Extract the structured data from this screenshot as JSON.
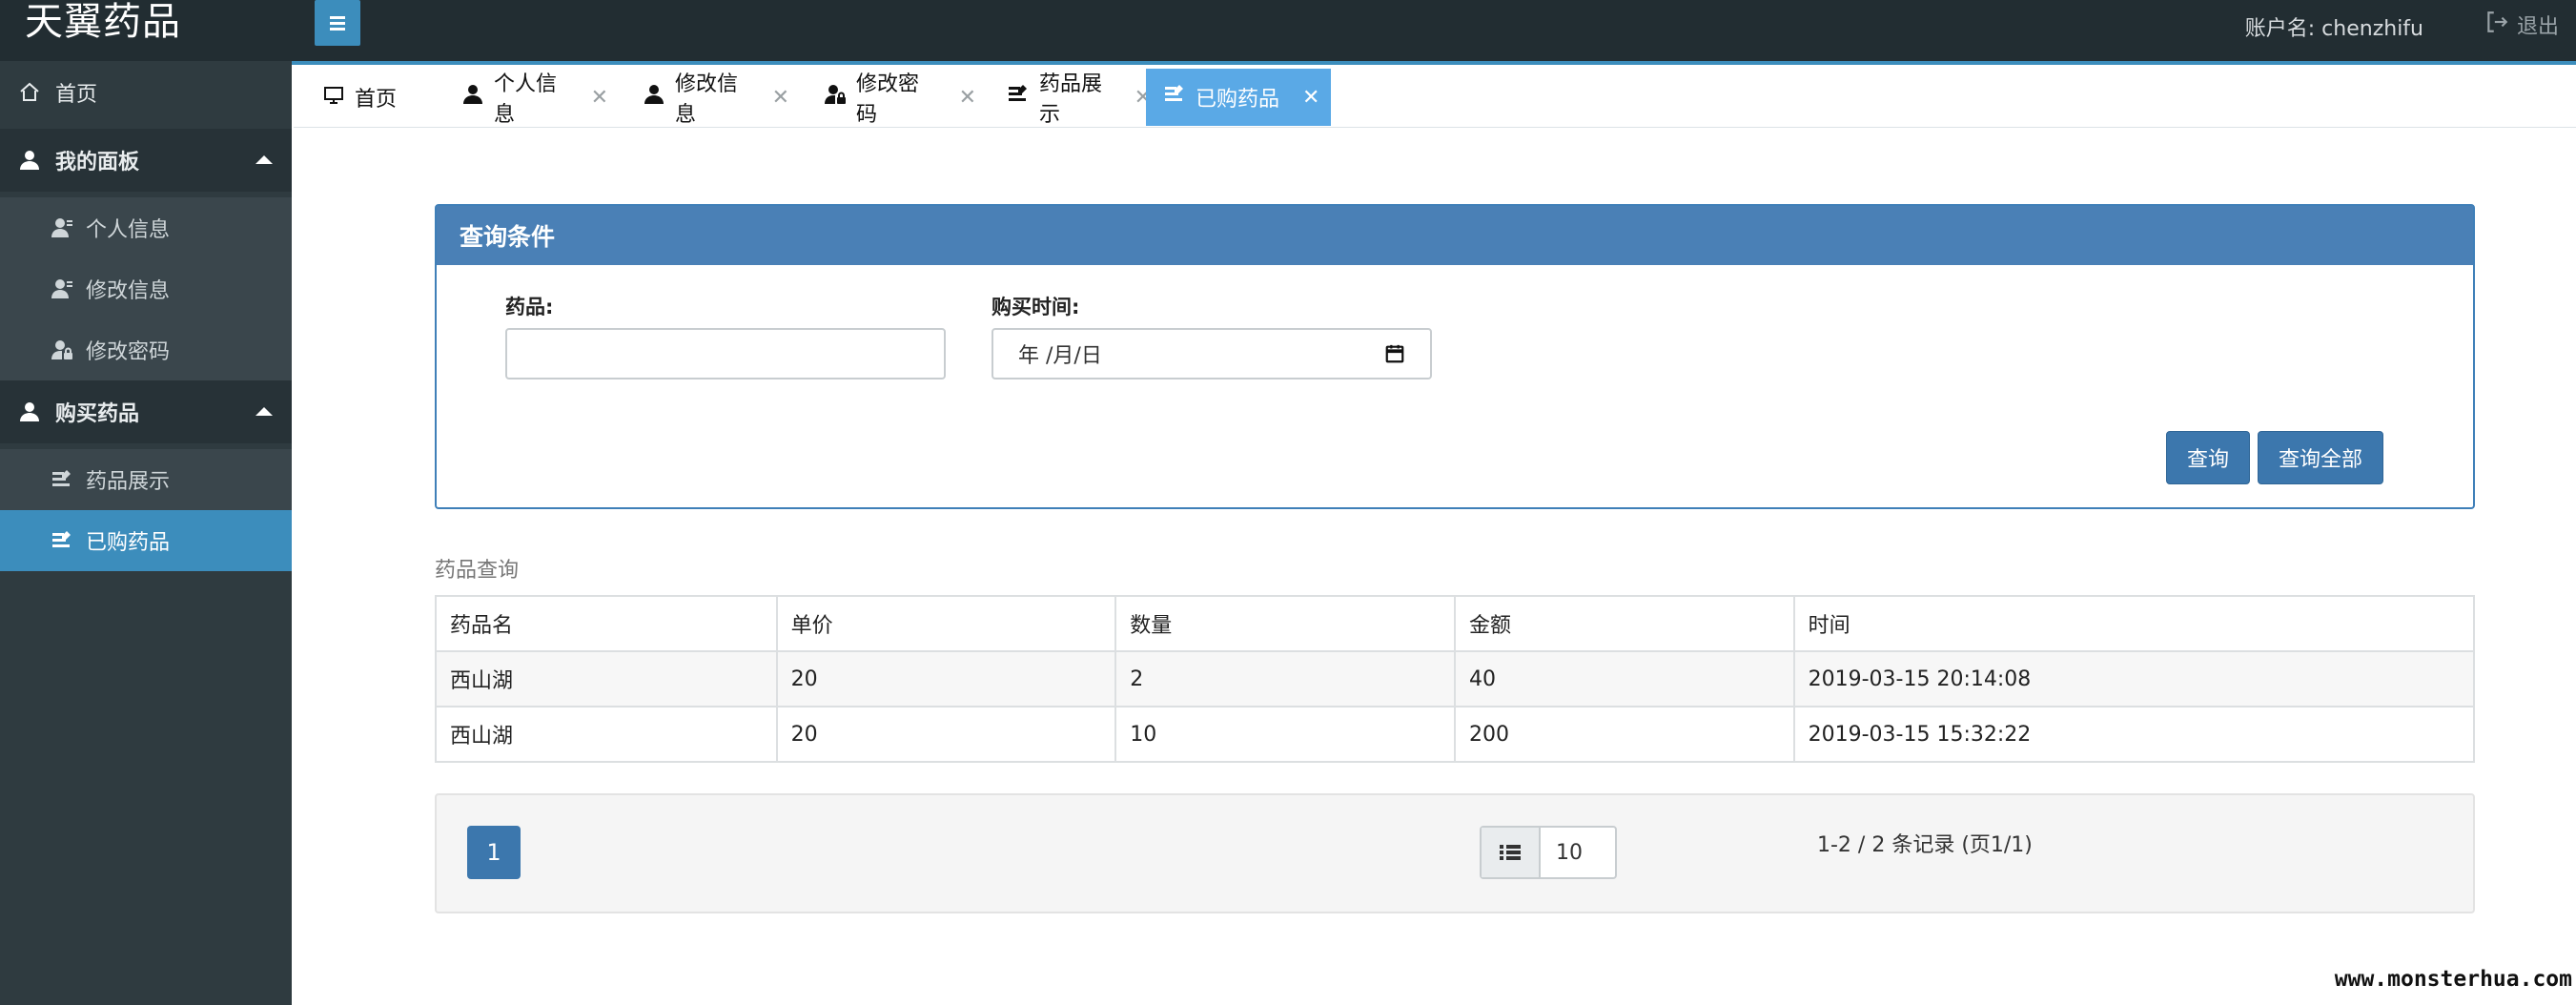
{
  "header": {
    "brand": "天翼药品",
    "account_label": "账户名: chenzhifu",
    "logout_label": "退出"
  },
  "sidebar": {
    "home": "首页",
    "groups": [
      {
        "label": "我的面板",
        "items": [
          "个人信息",
          "修改信息",
          "修改密码"
        ]
      },
      {
        "label": "购买药品",
        "items": [
          "药品展示",
          "已购药品"
        ]
      }
    ]
  },
  "tabs": [
    "首页",
    "个人信息",
    "修改信息",
    "修改密码",
    "药品展示",
    "已购药品"
  ],
  "active_tab": "已购药品",
  "query": {
    "title": "查询条件",
    "drug_label": "药品:",
    "drug_value": "",
    "date_label": "购买时间:",
    "date_placeholder": "年 /月/日",
    "query_button": "查询",
    "query_all_button": "查询全部"
  },
  "results": {
    "title": "药品查询",
    "columns": [
      "药品名",
      "单价",
      "数量",
      "金额",
      "时间"
    ],
    "rows": [
      [
        "西山湖",
        "20",
        "2",
        "40",
        "2019-03-15 20:14:08"
      ],
      [
        "西山湖",
        "20",
        "10",
        "200",
        "2019-03-15 15:32:22"
      ]
    ]
  },
  "pager": {
    "current_page": "1",
    "page_size": "10",
    "summary": "1-2 / 2 条记录 (页1/1)"
  },
  "watermark": "www.monsterhua.com",
  "colors": {
    "accent": "#3c8dbc",
    "sidebar": "#2f3b40",
    "panel_head": "#4a80b6"
  }
}
